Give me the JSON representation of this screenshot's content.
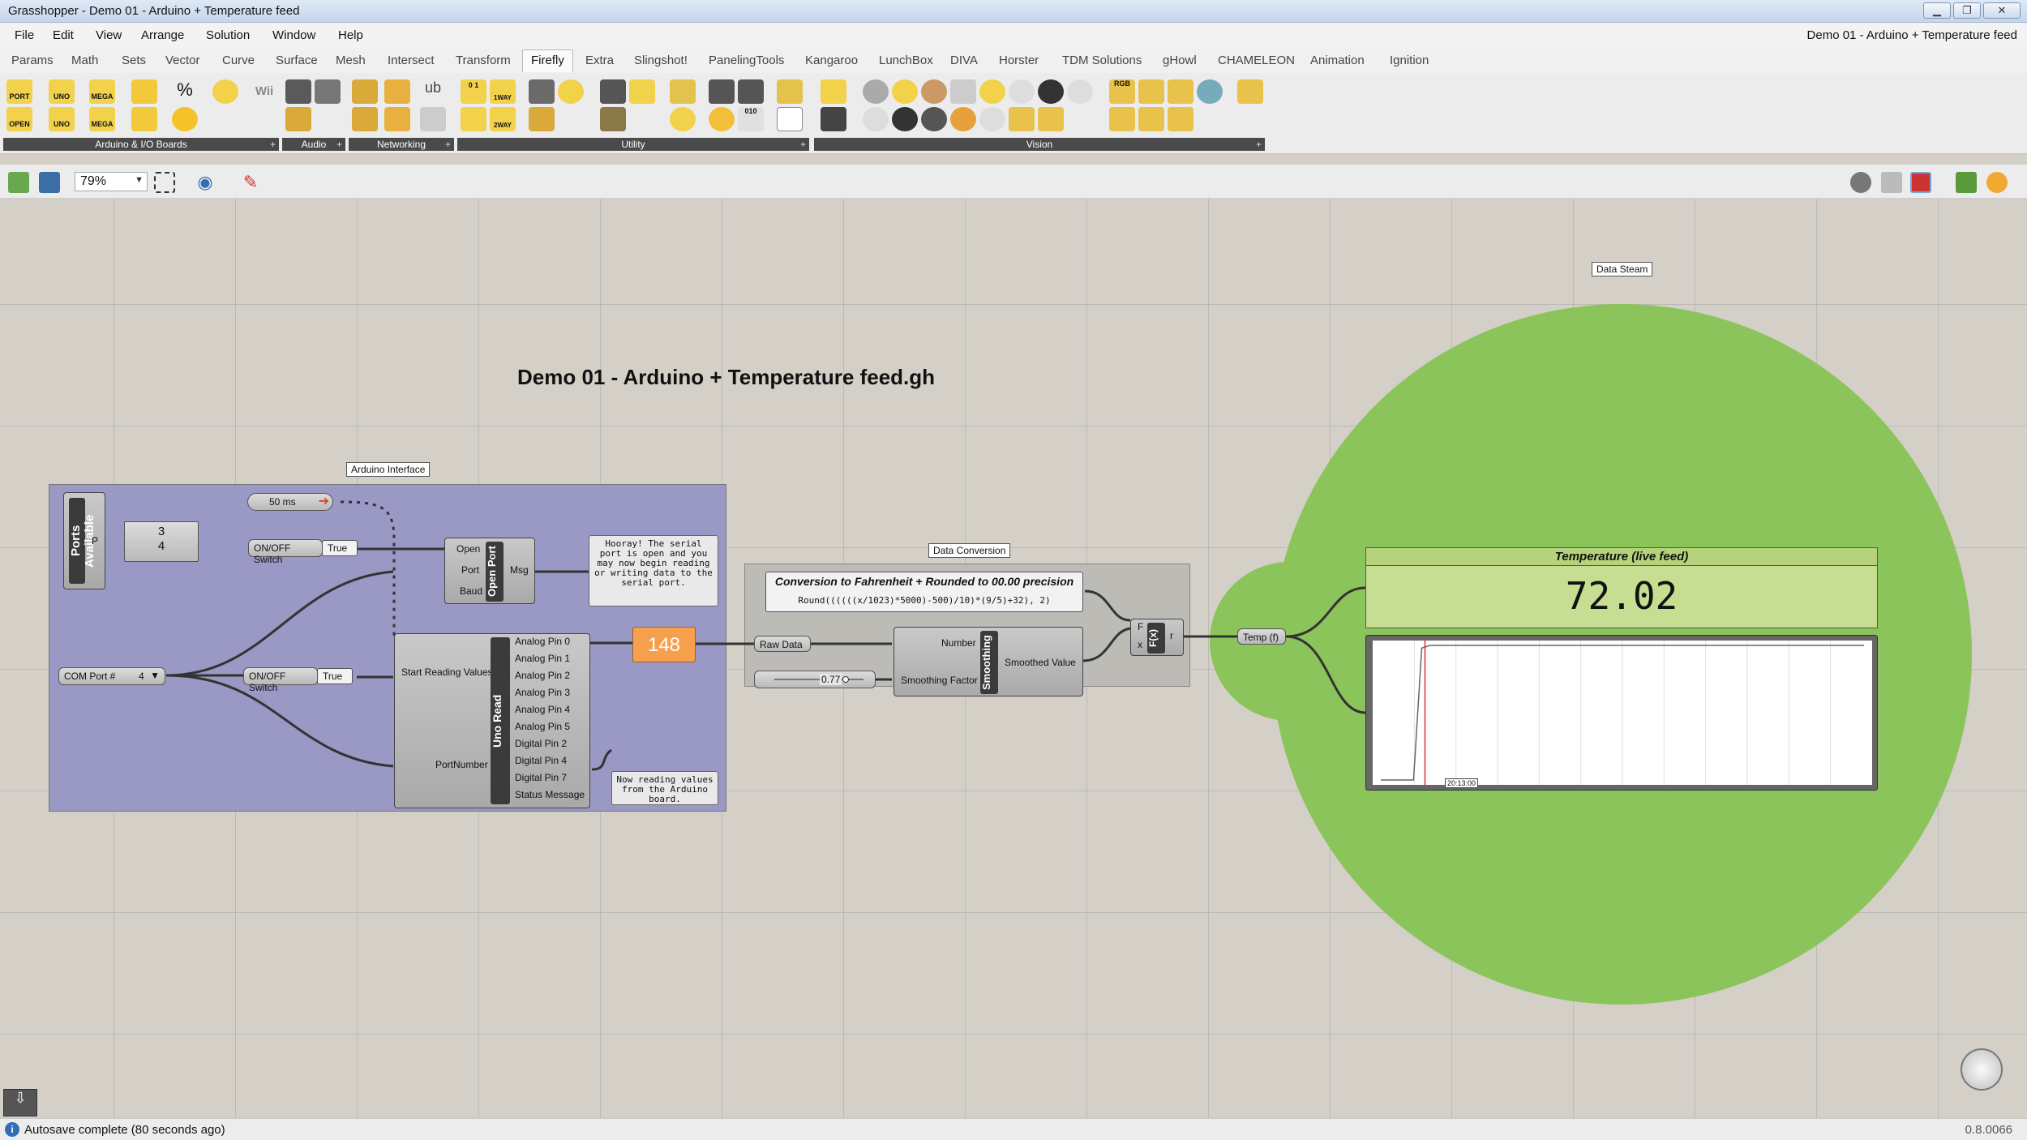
{
  "window": {
    "title": "Grasshopper - Demo 01 - Arduino + Temperature feed",
    "doc_title": "Demo 01 - Arduino + Temperature feed"
  },
  "menu": [
    "File",
    "Edit",
    "View",
    "Arrange",
    "Solution",
    "Window",
    "Help"
  ],
  "tabs": [
    "Params",
    "Math",
    "Sets",
    "Vector",
    "Curve",
    "Surface",
    "Mesh",
    "Intersect",
    "Transform",
    "Firefly",
    "Extra",
    "Slingshot!",
    "PanelingTools",
    "Kangaroo",
    "LunchBox",
    "DIVA",
    "Horster",
    "TDM Solutions",
    "gHowl",
    "CHAMELEON",
    "Animation",
    "Ignition"
  ],
  "active_tab": "Firefly",
  "ribbon_groups": [
    "Arduino & I/O Boards",
    "Audio",
    "Networking",
    "Utility",
    "Vision"
  ],
  "ribbon_icon_text": {
    "port": "PORT",
    "uno": "UNO",
    "mega": "MEGA",
    "open": "OPEN",
    "wii": "Wii",
    "oneway": "1WAY",
    "twoway": "2WAY",
    "counter": "0 1",
    "binary": "010",
    "rgb": "RGB"
  },
  "toolbar": {
    "zoom": "79%"
  },
  "canvas": {
    "title": "Demo 01 - Arduino + Temperature feed.gh",
    "groups": {
      "arduino": "Arduino Interface",
      "conversion": "Data Conversion",
      "stream": "Data Steam"
    },
    "ports_available": {
      "label": "Ports Available",
      "output": "P",
      "values": [
        "3",
        "4"
      ]
    },
    "timer": {
      "label": "50 ms"
    },
    "switch1": {
      "label": "ON/OFF Switch",
      "value": "True"
    },
    "switch2": {
      "label": "ON/OFF Switch",
      "value": "True"
    },
    "com_port": {
      "label": "COM Port #",
      "value": "4"
    },
    "open_port": {
      "name": "Open Port",
      "inputs": [
        "Open",
        "Port",
        "Baud"
      ],
      "output": "Msg"
    },
    "open_msg": "Hooray! The serial port is open and you may now begin reading or writing data to the serial port.",
    "uno_read": {
      "name": "Uno Read",
      "inputs": [
        "Start Reading Values",
        "PortNumber"
      ],
      "outputs": [
        "Analog Pin 0",
        "Analog Pin 1",
        "Analog Pin 2",
        "Analog Pin 3",
        "Analog Pin 4",
        "Analog Pin 5",
        "Digital Pin 2",
        "Digital Pin 4",
        "Digital Pin 7",
        "Status Message"
      ]
    },
    "status_msg": "Now reading values from the Arduino board.",
    "raw_value": "148",
    "raw_data_label": "Raw Data",
    "slider": {
      "value": "0.77"
    },
    "smoothing": {
      "name": "Smoothing",
      "inputs": [
        "Number",
        "Smoothing Factor"
      ],
      "output": "Smoothed Value"
    },
    "expression": {
      "title": "Conversion to Fahrenheit + Rounded to 00.00 precision",
      "formula": "Round((((((x/1023)*5000)-500)/10)*(9/5)+32), 2)"
    },
    "fx": {
      "name": "F(x)",
      "inputs": [
        "F",
        "x"
      ],
      "output": "r"
    },
    "temp_param": "Temp (f)",
    "panel": {
      "title": "Temperature (live feed)",
      "value": "72.02"
    },
    "recorder_time": "20:13:00",
    "colors": {
      "group_blue": "#9a98c4",
      "group_gray": "#bdbbb6",
      "green_blob": "#8bc45a",
      "number_orange": "#f6a04d"
    }
  },
  "chart_data": {
    "type": "line",
    "title": "",
    "xlabel": "",
    "ylabel": "",
    "x_tick_labels": [
      "20:13:00"
    ],
    "series": [
      {
        "values": [
          0,
          0,
          0,
          0,
          0,
          98,
          100,
          100,
          100,
          100,
          100,
          100,
          100,
          100,
          100,
          100,
          100,
          100,
          100,
          100,
          100,
          100,
          100,
          100,
          100,
          100,
          100,
          100,
          100,
          100,
          100,
          100,
          100,
          100,
          100,
          100,
          100,
          100,
          100,
          100,
          100,
          100,
          100,
          100,
          100,
          100,
          100,
          100,
          100,
          100,
          100,
          100,
          100,
          100,
          100,
          100,
          100,
          100,
          100,
          100
        ]
      }
    ],
    "ylim": [
      0,
      100
    ],
    "grid": true
  },
  "status": {
    "message": "Autosave complete (80 seconds ago)",
    "version": "0.8.0066"
  }
}
